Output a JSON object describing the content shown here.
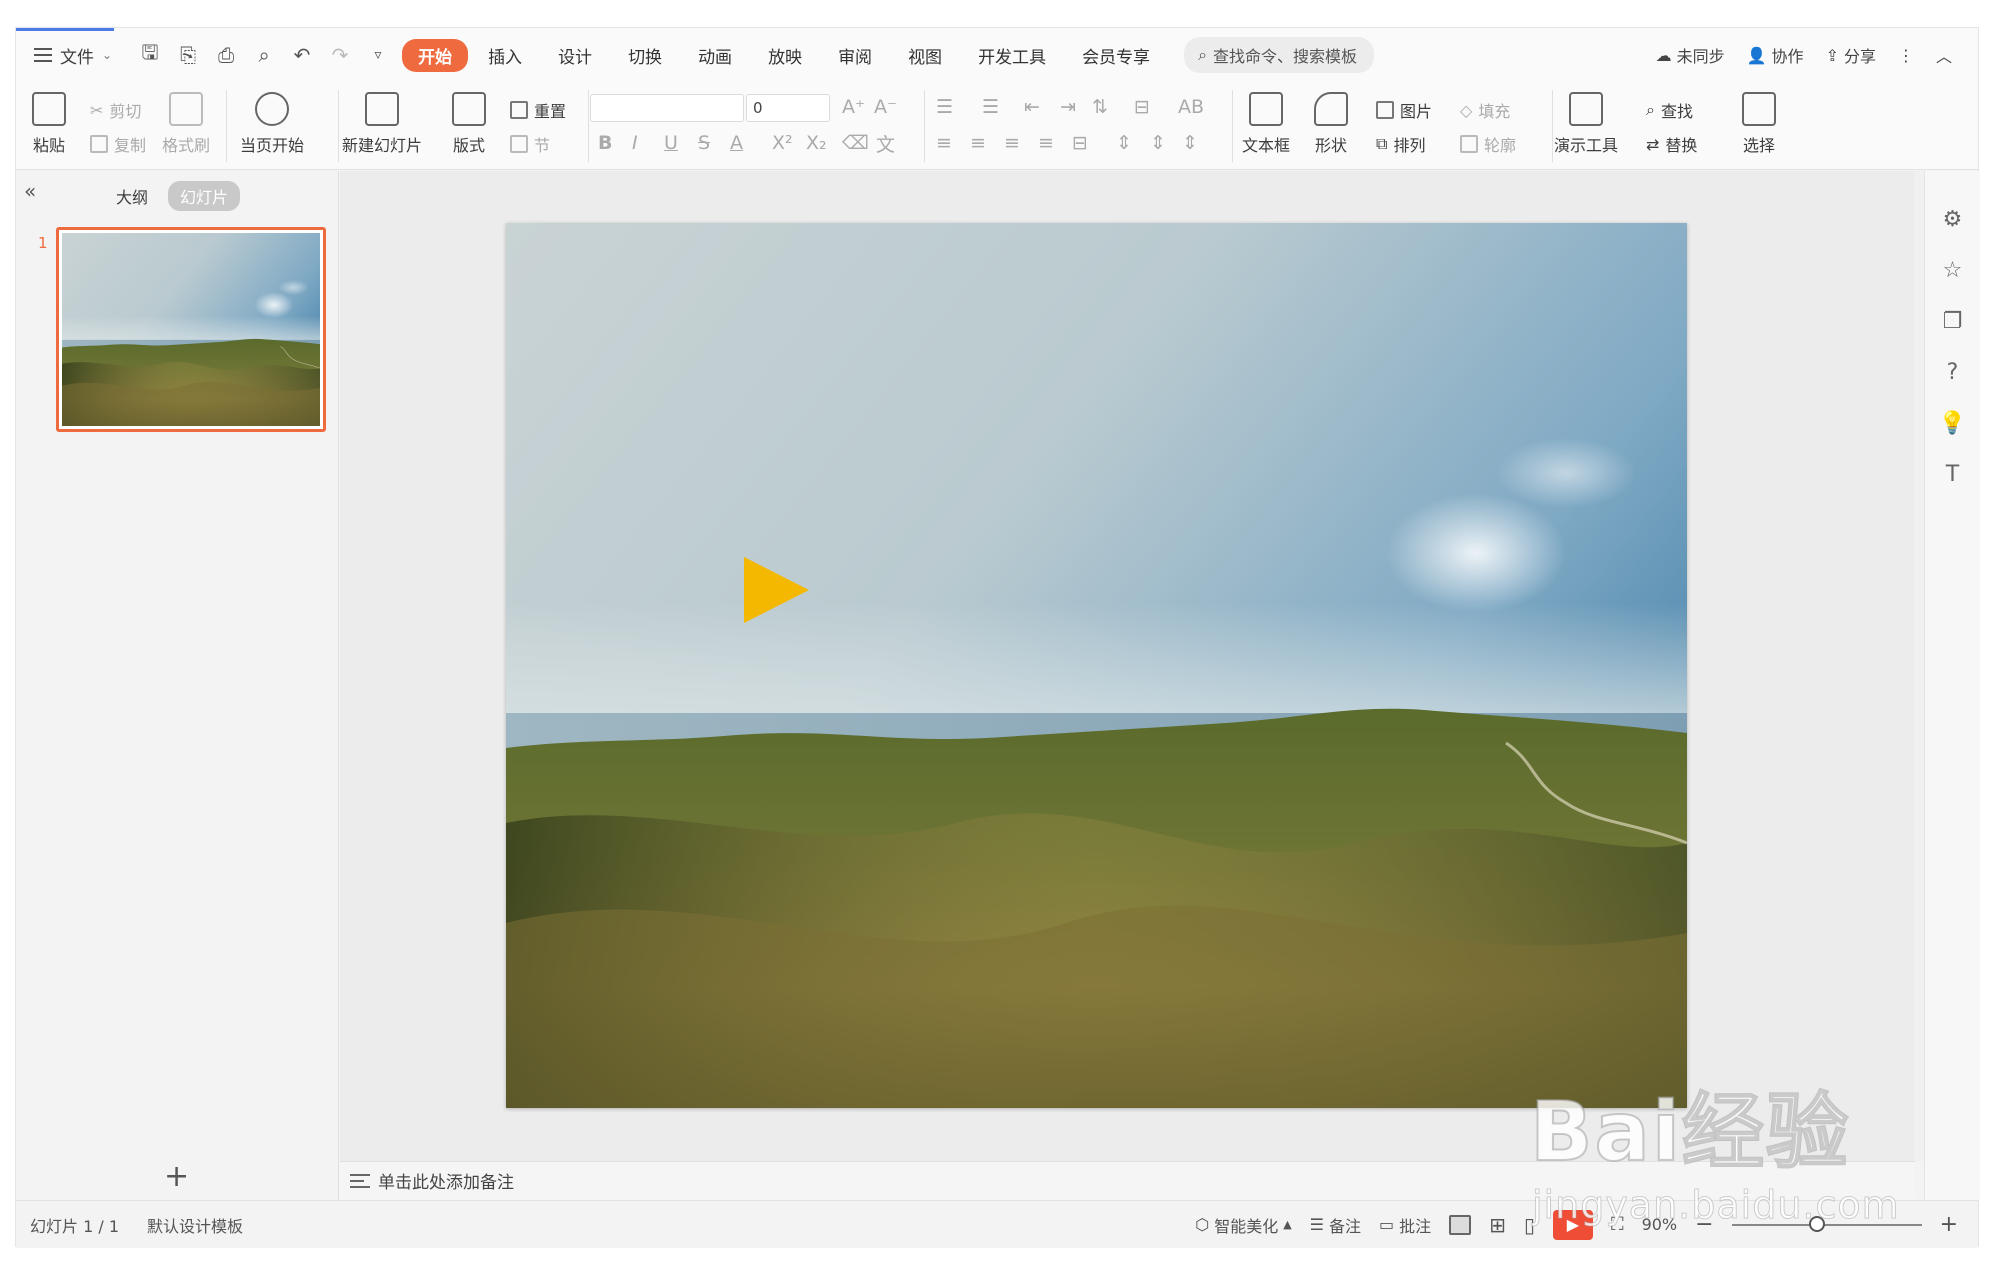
{
  "menu": {
    "file_label": "文件",
    "tabs": [
      "开始",
      "插入",
      "设计",
      "切换",
      "动画",
      "放映",
      "审阅",
      "视图",
      "开发工具",
      "会员专享"
    ],
    "active_tab": "开始",
    "search_placeholder": "查找命令、搜索模板",
    "sync_label": "未同步",
    "collab_label": "协作",
    "share_label": "分享"
  },
  "ribbon": {
    "paste": "粘贴",
    "cut": "剪切",
    "copy": "复制",
    "format_painter": "格式刷",
    "from_current": "当页开始",
    "new_slide": "新建幻灯片",
    "layout": "版式",
    "reset": "重置",
    "section": "节",
    "font_size_value": "0",
    "textbox": "文本框",
    "shape": "形状",
    "picture": "图片",
    "fill": "填充",
    "arrange": "排列",
    "outline": "轮廓",
    "presentation_tools": "演示工具",
    "find": "查找",
    "replace": "替换",
    "select": "选择"
  },
  "panel": {
    "outline_tab": "大纲",
    "slides_tab": "幻灯片",
    "slide_number": "1"
  },
  "notes": {
    "placeholder": "单击此处添加备注"
  },
  "status": {
    "slide_info": "幻灯片 1 / 1",
    "template": "默认设计模板",
    "smart_beautify": "智能美化",
    "notes": "备注",
    "comments": "批注",
    "zoom": "90%",
    "zoom_level": 0.45
  },
  "watermark": {
    "brand": "Bai经验",
    "url": "jingyan.baidu.com"
  },
  "colors": {
    "accent": "#ef6a3e",
    "play_triangle": "#f5b800",
    "tab_blue": "#4a7de8"
  }
}
